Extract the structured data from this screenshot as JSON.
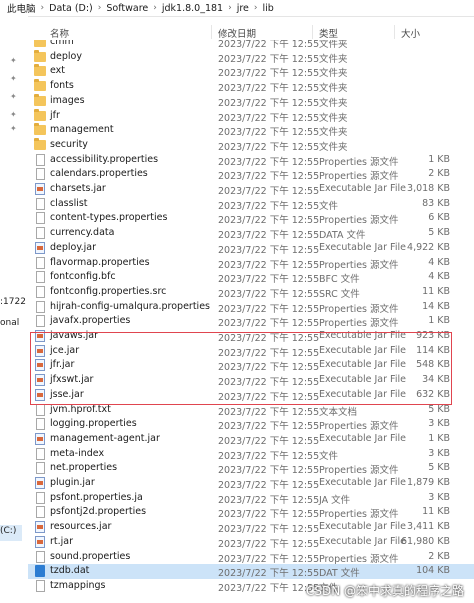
{
  "breadcrumb": [
    "此电脑",
    "Data (D:)",
    "Software",
    "jdk1.8.0_181",
    "jre",
    "lib"
  ],
  "columns": {
    "name": "名称",
    "date": "修改日期",
    "type": "类型",
    "size": "大小"
  },
  "nav": {
    "labels": [
      ":1722",
      "onal",
      "(C:)"
    ]
  },
  "rows": [
    {
      "name": "cmm",
      "date": "2023/7/22 下午 12:55",
      "type": "文件夹",
      "size": "",
      "icon": "folder"
    },
    {
      "name": "deploy",
      "date": "2023/7/22 下午 12:55",
      "type": "文件夹",
      "size": "",
      "icon": "folder"
    },
    {
      "name": "ext",
      "date": "2023/7/22 下午 12:55",
      "type": "文件夹",
      "size": "",
      "icon": "folder"
    },
    {
      "name": "fonts",
      "date": "2023/7/22 下午 12:55",
      "type": "文件夹",
      "size": "",
      "icon": "folder"
    },
    {
      "name": "images",
      "date": "2023/7/22 下午 12:55",
      "type": "文件夹",
      "size": "",
      "icon": "folder"
    },
    {
      "name": "jfr",
      "date": "2023/7/22 下午 12:55",
      "type": "文件夹",
      "size": "",
      "icon": "folder"
    },
    {
      "name": "management",
      "date": "2023/7/22 下午 12:55",
      "type": "文件夹",
      "size": "",
      "icon": "folder"
    },
    {
      "name": "security",
      "date": "2023/7/22 下午 12:55",
      "type": "文件夹",
      "size": "",
      "icon": "folder"
    },
    {
      "name": "accessibility.properties",
      "date": "2023/7/22 下午 12:55",
      "type": "Properties 源文件",
      "size": "1 KB",
      "icon": "file"
    },
    {
      "name": "calendars.properties",
      "date": "2023/7/22 下午 12:55",
      "type": "Properties 源文件",
      "size": "2 KB",
      "icon": "file"
    },
    {
      "name": "charsets.jar",
      "date": "2023/7/22 下午 12:55",
      "type": "Executable Jar File",
      "size": "3,018 KB",
      "icon": "jar"
    },
    {
      "name": "classlist",
      "date": "2023/7/22 下午 12:55",
      "type": "文件",
      "size": "83 KB",
      "icon": "file"
    },
    {
      "name": "content-types.properties",
      "date": "2023/7/22 下午 12:55",
      "type": "Properties 源文件",
      "size": "6 KB",
      "icon": "file"
    },
    {
      "name": "currency.data",
      "date": "2023/7/22 下午 12:55",
      "type": "DATA 文件",
      "size": "5 KB",
      "icon": "file"
    },
    {
      "name": "deploy.jar",
      "date": "2023/7/22 下午 12:55",
      "type": "Executable Jar File",
      "size": "4,922 KB",
      "icon": "jar"
    },
    {
      "name": "flavormap.properties",
      "date": "2023/7/22 下午 12:55",
      "type": "Properties 源文件",
      "size": "4 KB",
      "icon": "file"
    },
    {
      "name": "fontconfig.bfc",
      "date": "2023/7/22 下午 12:55",
      "type": "BFC 文件",
      "size": "4 KB",
      "icon": "file"
    },
    {
      "name": "fontconfig.properties.src",
      "date": "2023/7/22 下午 12:55",
      "type": "SRC 文件",
      "size": "11 KB",
      "icon": "file"
    },
    {
      "name": "hijrah-config-umalqura.properties",
      "date": "2023/7/22 下午 12:55",
      "type": "Properties 源文件",
      "size": "14 KB",
      "icon": "file"
    },
    {
      "name": "javafx.properties",
      "date": "2023/7/22 下午 12:55",
      "type": "Properties 源文件",
      "size": "1 KB",
      "icon": "file"
    },
    {
      "name": "javaws.jar",
      "date": "2023/7/22 下午 12:55",
      "type": "Executable Jar File",
      "size": "923 KB",
      "icon": "jar"
    },
    {
      "name": "jce.jar",
      "date": "2023/7/22 下午 12:55",
      "type": "Executable Jar File",
      "size": "114 KB",
      "icon": "jar"
    },
    {
      "name": "jfr.jar",
      "date": "2023/7/22 下午 12:55",
      "type": "Executable Jar File",
      "size": "548 KB",
      "icon": "jar"
    },
    {
      "name": "jfxswt.jar",
      "date": "2023/7/22 下午 12:55",
      "type": "Executable Jar File",
      "size": "34 KB",
      "icon": "jar"
    },
    {
      "name": "jsse.jar",
      "date": "2023/7/22 下午 12:55",
      "type": "Executable Jar File",
      "size": "632 KB",
      "icon": "jar"
    },
    {
      "name": "jvm.hprof.txt",
      "date": "2023/7/22 下午 12:55",
      "type": "文本文档",
      "size": "5 KB",
      "icon": "file"
    },
    {
      "name": "logging.properties",
      "date": "2023/7/22 下午 12:55",
      "type": "Properties 源文件",
      "size": "3 KB",
      "icon": "file"
    },
    {
      "name": "management-agent.jar",
      "date": "2023/7/22 下午 12:55",
      "type": "Executable Jar File",
      "size": "1 KB",
      "icon": "jar"
    },
    {
      "name": "meta-index",
      "date": "2023/7/22 下午 12:55",
      "type": "文件",
      "size": "3 KB",
      "icon": "file"
    },
    {
      "name": "net.properties",
      "date": "2023/7/22 下午 12:55",
      "type": "Properties 源文件",
      "size": "5 KB",
      "icon": "file"
    },
    {
      "name": "plugin.jar",
      "date": "2023/7/22 下午 12:55",
      "type": "Executable Jar File",
      "size": "1,879 KB",
      "icon": "jar"
    },
    {
      "name": "psfont.properties.ja",
      "date": "2023/7/22 下午 12:55",
      "type": "JA 文件",
      "size": "3 KB",
      "icon": "file"
    },
    {
      "name": "psfontj2d.properties",
      "date": "2023/7/22 下午 12:55",
      "type": "Properties 源文件",
      "size": "11 KB",
      "icon": "file"
    },
    {
      "name": "resources.jar",
      "date": "2023/7/22 下午 12:55",
      "type": "Executable Jar File",
      "size": "3,411 KB",
      "icon": "jar"
    },
    {
      "name": "rt.jar",
      "date": "2023/7/22 下午 12:55",
      "type": "Executable Jar File",
      "size": "61,980 KB",
      "icon": "jar"
    },
    {
      "name": "sound.properties",
      "date": "2023/7/22 下午 12:55",
      "type": "Properties 源文件",
      "size": "2 KB",
      "icon": "file"
    },
    {
      "name": "tzdb.dat",
      "date": "2023/7/22 下午 12:55",
      "type": "DAT 文件",
      "size": "104 KB",
      "icon": "dat",
      "selected": true
    },
    {
      "name": "tzmappings",
      "date": "2023/7/22 下午 12:55",
      "type": "文件",
      "size": "",
      "icon": "file"
    }
  ],
  "watermark": "CSDN @笨中求真的程序之路",
  "colors": {
    "selection": "#cce3f8",
    "highlight": "#e0454f",
    "folder": "#f4c55b"
  }
}
